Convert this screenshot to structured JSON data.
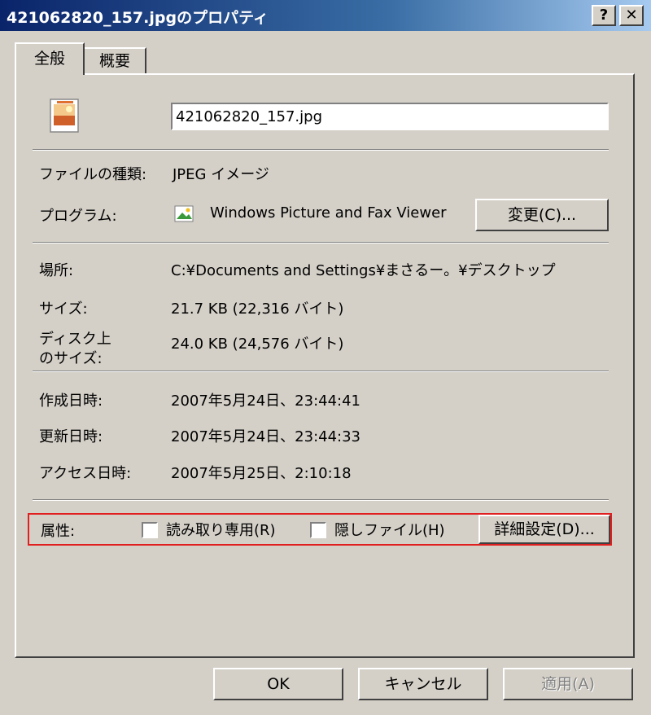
{
  "window": {
    "title": "421062820_157.jpgのプロパティ",
    "help_label": "?",
    "close_label": "✕"
  },
  "tabs": [
    {
      "label": "全般"
    },
    {
      "label": "概要"
    }
  ],
  "file": {
    "name": "421062820_157.jpg",
    "icon": "jpeg-image-icon"
  },
  "type_row": {
    "label": "ファイルの種類:",
    "value": "JPEG イメージ"
  },
  "program_row": {
    "label": "プログラム:",
    "value": "Windows Picture and Fax Viewer",
    "icon": "picture-viewer-icon",
    "change_button": "変更(C)..."
  },
  "location_row": {
    "label": "場所:",
    "value": "C:¥Documents and Settings¥まさるー。¥デスクトップ"
  },
  "size_row": {
    "label": "サイズ:",
    "value": "21.7 KB (22,316 バイト)"
  },
  "disk_size_row": {
    "label_line1": "ディスク上",
    "label_line2": "のサイズ:",
    "value": "24.0 KB (24,576 バイト)"
  },
  "created_row": {
    "label": "作成日時:",
    "value": "2007年5月24日、23:44:41"
  },
  "modified_row": {
    "label": "更新日時:",
    "value": "2007年5月24日、23:44:33"
  },
  "accessed_row": {
    "label": "アクセス日時:",
    "value": "2007年5月25日、2:10:18"
  },
  "attributes": {
    "label": "属性:",
    "readonly_label": "読み取り専用(R)",
    "readonly_checked": false,
    "hidden_label": "隠しファイル(H)",
    "hidden_checked": false,
    "advanced_button": "詳細設定(D)...",
    "highlight_color": "#e02020"
  },
  "footer": {
    "ok": "OK",
    "cancel": "キャンセル",
    "apply": "適用(A)"
  },
  "colors": {
    "face": "#d4d0c8",
    "title_start": "#0a246a",
    "title_end": "#a6caf0"
  }
}
